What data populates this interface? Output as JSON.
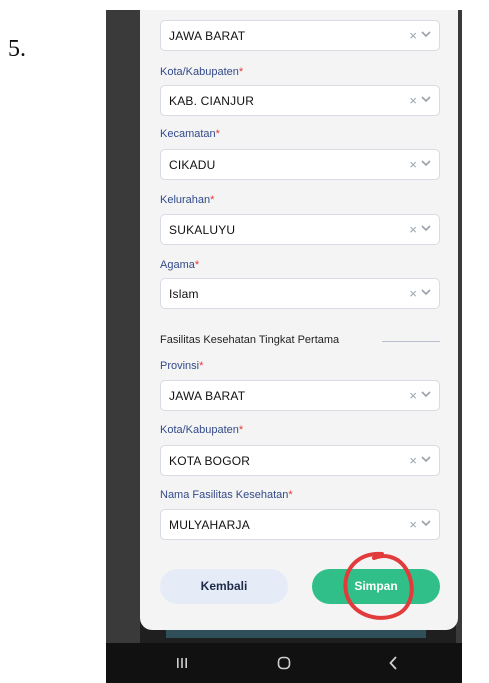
{
  "step_number": "5.",
  "form": {
    "fields": [
      {
        "label": "",
        "value": "JAWA BARAT"
      },
      {
        "label": "Kota/Kabupaten",
        "value": "KAB. CIANJUR"
      },
      {
        "label": "Kecamatan",
        "value": "CIKADU"
      },
      {
        "label": "Kelurahan",
        "value": "SUKALUYU"
      },
      {
        "label": "Agama",
        "value": "Islam"
      }
    ],
    "section_title": "Fasilitas Kesehatan Tingkat Pertama",
    "faskes_fields": [
      {
        "label": "Provinsi",
        "value": "JAWA BARAT"
      },
      {
        "label": "Kota/Kabupaten",
        "value": "KOTA BOGOR"
      },
      {
        "label": "Nama Fasilitas Kesehatan",
        "value": "MULYAHARJA"
      }
    ],
    "required_marker": "*",
    "clear_glyph": "×"
  },
  "buttons": {
    "back_label": "Kembali",
    "save_label": "Simpan"
  },
  "colors": {
    "label": "#334a8a",
    "required": "#e53935",
    "save_button": "#31bf89",
    "back_button": "#e5ecf8",
    "annotation_circle": "#e23b3b"
  },
  "navbar": {
    "icons": [
      "recent-apps-icon",
      "home-icon",
      "back-icon"
    ]
  }
}
